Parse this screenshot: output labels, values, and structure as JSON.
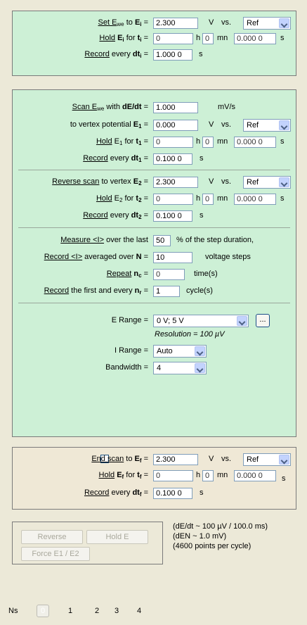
{
  "panel1": {
    "set_label": "Set E",
    "set_sub": "we",
    "set_to": " to ",
    "set_var": "E",
    "set_var_sub": "i",
    "set_value": "2.300",
    "set_unit": "V",
    "vs": "vs.",
    "set_ref": "Ref",
    "hold_label": "Hold",
    "hold_var": "E",
    "hold_var_sub": "i",
    "hold_for": " for ",
    "hold_t": "t",
    "hold_t_sub": "i",
    "hold_h": "0",
    "hold_mn": "0",
    "hold_s": "0.000 0",
    "rec_label": "Record",
    "rec_every": " every ",
    "rec_var": "dt",
    "rec_var_sub": "i",
    "rec_value": "1.000 0",
    "unit_h": "h",
    "unit_mn": "mn",
    "unit_s": "s"
  },
  "panel2": {
    "scan_label": "Scan E",
    "scan_sub": "we",
    "scan_with": " with ",
    "scan_var": "dE/dt",
    "scan_value": "1.000",
    "scan_unit": "mV/s",
    "vertex_label": "to vertex potential",
    "vertex_var": "E",
    "vertex_sub": "1",
    "vertex_value": "0.000",
    "vertex_unit": "V",
    "vertex_vs": "vs.",
    "vertex_ref": "Ref",
    "hold1_label": "Hold",
    "hold1_var": "E",
    "hold1_sub": "1",
    "hold1_for": " for ",
    "hold1_t": "t",
    "hold1_t_sub": "1",
    "hold1_h": "0",
    "hold1_mn": "0",
    "hold1_s": "0.000 0",
    "rec1_label": "Record",
    "rec1_every": " every ",
    "rec1_var": "dt",
    "rec1_sub": "1",
    "rec1_value": "0.100 0",
    "rev_label": "Reverse scan",
    "rev_to": " to vertex ",
    "rev_var": "E",
    "rev_sub": "2",
    "rev_value": "2.300",
    "rev_unit": "V",
    "rev_vs": "vs.",
    "rev_ref": "Ref",
    "hold2_label": "Hold",
    "hold2_var": "E",
    "hold2_sub": "2",
    "hold2_for": " for ",
    "hold2_t": "t",
    "hold2_t_sub": "2",
    "hold2_h": "0",
    "hold2_mn": "0",
    "hold2_s": "0.000 0",
    "rec2_label": "Record",
    "rec2_every": " every ",
    "rec2_var": "dt",
    "rec2_sub": "2",
    "rec2_value": "0.100 0",
    "measure_label": "Measure <I>",
    "measure_rest": " over the last",
    "measure_value": "50",
    "measure_unit": "% of the step duration,",
    "avg_label": "Record <I>",
    "avg_rest": " averaged over ",
    "avg_var": "N",
    "avg_value": "10",
    "avg_unit": "voltage steps",
    "repeat_label": "Repeat",
    "repeat_var": "n",
    "repeat_sub": "c",
    "repeat_value": "0",
    "repeat_unit": "time(s)",
    "recfirst_label": "Record",
    "recfirst_rest": " the first and every ",
    "recfirst_var": "n",
    "recfirst_sub": "r",
    "recfirst_value": "1",
    "recfirst_unit": "cycle(s)",
    "erange_label": "E Range =",
    "erange_value": "0 V; 5 V",
    "erange_more": "...",
    "resolution": "Resolution = 100 µV",
    "irange_label": "I Range =",
    "irange_value": "Auto",
    "bandwidth_label": "Bandwidth =",
    "bandwidth_value": "4",
    "unit_h": "h",
    "unit_mn": "mn",
    "unit_s": "s",
    "unit_v": "V",
    "eq": "="
  },
  "panel3": {
    "end_label": "End scan",
    "end_to": " to ",
    "end_var": "E",
    "end_sub": "f",
    "end_value": "2.300",
    "end_unit": "V",
    "end_vs": "vs.",
    "end_ref": "Ref",
    "hold_label": "Hold",
    "hold_var": "E",
    "hold_sub": "f",
    "hold_for": " for ",
    "hold_t": "t",
    "hold_t_sub": "f",
    "hold_h": "0",
    "hold_mn": "0",
    "hold_s": "0.000 0",
    "rec_label": "Record",
    "rec_every": " every ",
    "rec_var": "dt",
    "rec_sub": "f",
    "rec_value": "0.100 0",
    "unit_h": "h",
    "unit_mn": "mn",
    "unit_s": "s"
  },
  "controls": {
    "reverse": "Reverse",
    "hold_e": "Hold E",
    "force": "Force E1 / E2",
    "info1": "(dE/dt ~ 100 µV / 100.0 ms)",
    "info2": "(dEN ~ 1.0 mV)",
    "info3": "(4600 points per cycle)"
  },
  "ns": {
    "label": "Ns",
    "current": "0",
    "items": [
      "1",
      "2",
      "3",
      "4"
    ]
  }
}
